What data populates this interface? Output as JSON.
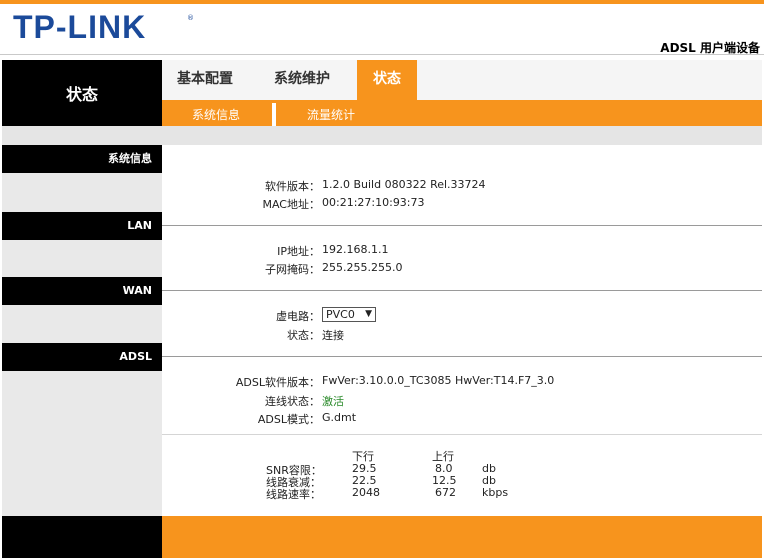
{
  "brand": {
    "logo": "TP-LINK",
    "registered": "®",
    "product": "ADSL 用户端设备"
  },
  "nav": {
    "left_title": "状态",
    "tabs": [
      {
        "label": "基本配置",
        "active": false
      },
      {
        "label": "系统维护",
        "active": false
      },
      {
        "label": "状态",
        "active": true
      }
    ],
    "subtabs": [
      {
        "label": "系统信息"
      },
      {
        "label": "流量统计"
      }
    ]
  },
  "sections": {
    "system": {
      "title": "系统信息",
      "software_label": "软件版本：",
      "software_value": "1.2.0 Build 080322 Rel.33724",
      "mac_label": "MAC地址：",
      "mac_value": "00:21:27:10:93:73"
    },
    "lan": {
      "title": "LAN",
      "ip_label": "IP地址：",
      "ip_value": "192.168.1.1",
      "mask_label": "子网掩码：",
      "mask_value": "255.255.255.0"
    },
    "wan": {
      "title": "WAN",
      "vc_label": "虚电路：",
      "vc_value": "PVC0",
      "state_label": "状态：",
      "state_value": "连接"
    },
    "adsl": {
      "title": "ADSL",
      "fw_label": "ADSL软件版本：",
      "fw_value": "FwVer:3.10.0.0_TC3085 HwVer:T14.F7_3.0",
      "line_label": "连线状态：",
      "line_value": "激活",
      "mode_label": "ADSL模式：",
      "mode_value": "G.dmt",
      "table": {
        "headers": [
          "下行",
          "上行"
        ],
        "rows": [
          {
            "label": "SNR容限：",
            "down": "29.5",
            "up": "8.0",
            "unit": "db"
          },
          {
            "label": "线路衰减：",
            "down": "22.5",
            "up": "12.5",
            "unit": "db"
          },
          {
            "label": "线路速率：",
            "down": "2048",
            "up": "672",
            "unit": "kbps"
          }
        ]
      }
    }
  },
  "colors": {
    "accent": "#f7941d",
    "logo": "#1b4a9a",
    "dark": "#000000",
    "active_green": "#2a8a2a"
  }
}
